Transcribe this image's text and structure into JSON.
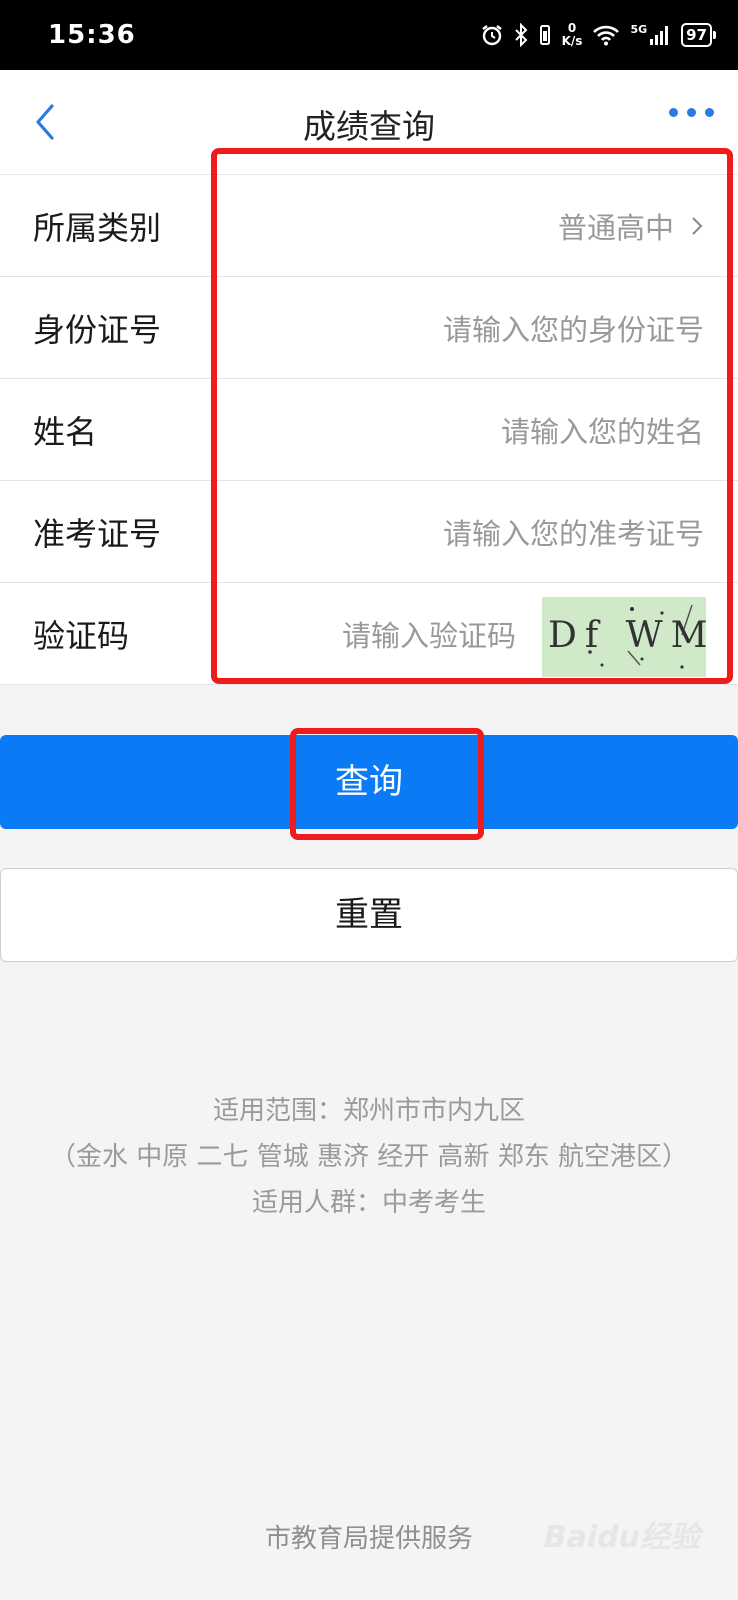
{
  "status_bar": {
    "time": "15:36",
    "net_speed_value": "0",
    "net_speed_unit": "K/s",
    "network": "5G",
    "battery": "97",
    "icons": [
      "alarm-icon",
      "bluetooth-icon",
      "vibrate-icon",
      "wifi-icon",
      "signal-icon",
      "battery-icon"
    ]
  },
  "nav": {
    "title": "成绩查询",
    "back_icon": "chevron-left-icon",
    "more_icon": "more-dots-icon"
  },
  "form": {
    "category": {
      "label": "所属类别",
      "value": "普通高中"
    },
    "id_number": {
      "label": "身份证号",
      "placeholder": "请输入您的身份证号"
    },
    "name": {
      "label": "姓名",
      "placeholder": "请输入您的姓名"
    },
    "exam_number": {
      "label": "准考证号",
      "placeholder": "请输入您的准考证号"
    },
    "captcha": {
      "label": "验证码",
      "placeholder": "请输入验证码",
      "image_text": "Df WM"
    }
  },
  "buttons": {
    "query": "查询",
    "reset": "重置"
  },
  "info": {
    "scope": "适用范围：郑州市市内九区",
    "districts": "（金水 中原 二七 管城 惠济 经开 高新 郑东 航空港区）",
    "audience": "适用人群：中考考生"
  },
  "footer": "市教育局提供服务",
  "watermark": "Baidu经验",
  "colors": {
    "primary": "#0a7bf5",
    "highlight": "#ee1c1c",
    "nav_icon": "#2a7ae0"
  }
}
